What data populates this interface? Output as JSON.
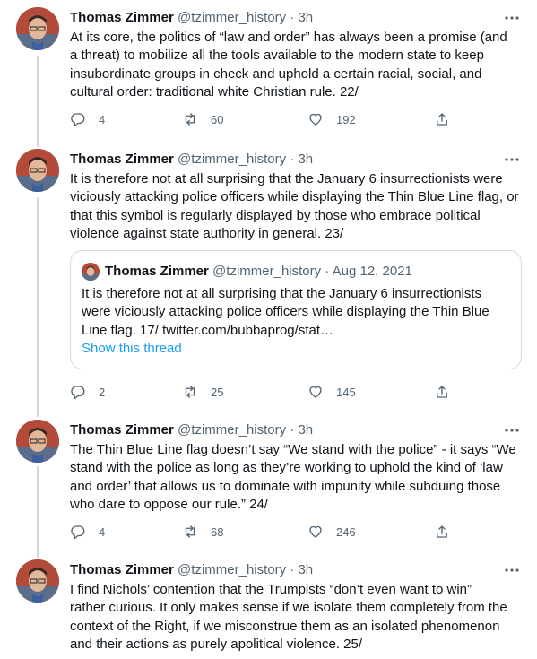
{
  "tweets": [
    {
      "name": "Thomas Zimmer",
      "handle": "@tzimmer_history",
      "time": "· 3h",
      "text": "At its core, the politics of “law and order” has always been a promise (and\na threat) to mobilize all the tools available to the modern state to keep\ninsubordinate groups in check and uphold a certain racial, social, and\ncultural order: traditional white Christian rule. 22/",
      "replies": "4",
      "retweets": "60",
      "likes": "192"
    },
    {
      "name": "Thomas Zimmer",
      "handle": "@tzimmer_history",
      "time": "· 3h",
      "text": "It is therefore not at all surprising that the January 6 insurrectionists were\nviciously attacking police officers while displaying the Thin Blue Line flag, or\nthat this symbol is regularly displayed by those who embrace political\nviolence against state authority in general. 23/",
      "replies": "2",
      "retweets": "25",
      "likes": "145",
      "quote": {
        "name": "Thomas Zimmer",
        "handle": "@tzimmer_history",
        "date": "· Aug 12, 2021",
        "text": "It is therefore not at all surprising that the January 6 insurrectionists\nwere viciously attacking police officers while displaying the Thin Blue\nLine flag. 17/ twitter.com/bubbaprog/stat…",
        "link": "Show this thread"
      }
    },
    {
      "name": "Thomas Zimmer",
      "handle": "@tzimmer_history",
      "time": "· 3h",
      "text": "The Thin Blue Line flag doesn’t say “We stand with the police” - it says “We\nstand with the police as long as they’re working to uphold the kind of ‘law\nand order’ that allows us to dominate with impunity while subduing those\nwho dare to oppose our rule.” 24/",
      "replies": "4",
      "retweets": "68",
      "likes": "246"
    },
    {
      "name": "Thomas Zimmer",
      "handle": "@tzimmer_history",
      "time": "· 3h",
      "text": "I find Nichols’ contention that the Trumpists “don’t even want to win”\nrather curious. It only makes sense if we isolate them completely from the\ncontext of the Right, if we misconstrue them as an isolated phenomenon\nand their actions as purely apolitical violence. 25/"
    }
  ],
  "icons": {
    "reply": "reply-icon",
    "retweet": "retweet-icon",
    "like": "like-icon",
    "share": "share-icon",
    "more": "more-icon"
  },
  "colors": {
    "text": "#0f1419",
    "muted": "#536471",
    "link": "#1d9bf0",
    "border": "#cfd9de",
    "thread_line": "#cfd9de"
  }
}
